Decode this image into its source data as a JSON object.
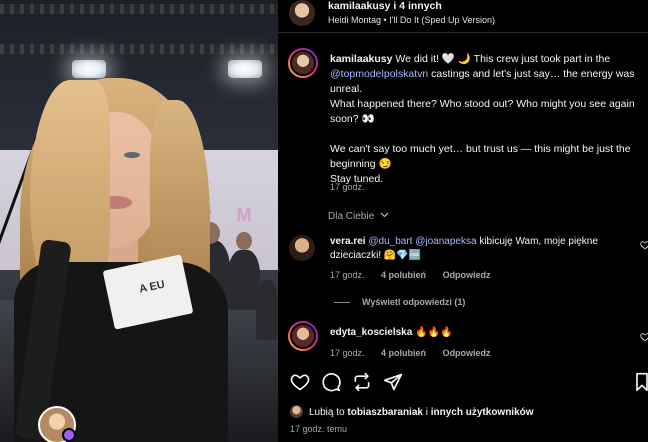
{
  "header": {
    "account_line": "kamilaakusy i 4 innych",
    "music_artist": "Heidi Montag",
    "music_separator": "•",
    "music_title": "I'll Do It (Sped Up Version)"
  },
  "video": {
    "wall_text": "P  M  O",
    "badge_text": "A EU"
  },
  "caption": {
    "username": "kamilaakusy",
    "line1_before": " We did it! 🤍 🌙 This crew just took part in the",
    "mention": "@topmodelpolskatvn",
    "line1_after": " castings and let's just say… the energy was unreal.",
    "para2": "What happened there? Who stood out? Who might you see again soon? 👀",
    "para3": "We can't say too much yet… but trust us — this might be just the beginning 😏",
    "para4": "Stay tuned.",
    "time": "17 godz."
  },
  "for_you": {
    "label": "Dla Ciebie",
    "chevron": "chevron-down-icon"
  },
  "comments": [
    {
      "username": "vera.rei",
      "mention1": "@du_bart",
      "mention2": "@joanapeksa",
      "text": " kibicuję Wam, moje piękne dzieciaczki! 🤗💎🆒",
      "time": "17 godz.",
      "likes": "4 polubień",
      "reply": "Odpowiedz",
      "view_replies": "Wyświetl odpowiedzi (1)"
    },
    {
      "username": "edyta_koscielska",
      "text": " 🔥🔥🔥",
      "time": "17 godz.",
      "likes": "4 polubień",
      "reply": "Odpowiedz"
    }
  ],
  "actions": {
    "like_icon": "heart-icon",
    "comment_icon": "comment-icon",
    "repost_icon": "repost-icon",
    "share_icon": "send-icon",
    "save_icon": "bookmark-icon"
  },
  "likes_line": {
    "prefix": "Lubią to ",
    "user": "tobiaszbaraniak",
    "middle": " i ",
    "others": "innych użytkowników"
  },
  "post_time": "17 godz. temu",
  "colors": {
    "background": "#000000",
    "muted": "#a8a8a8",
    "mention": "#a8b8ff"
  }
}
